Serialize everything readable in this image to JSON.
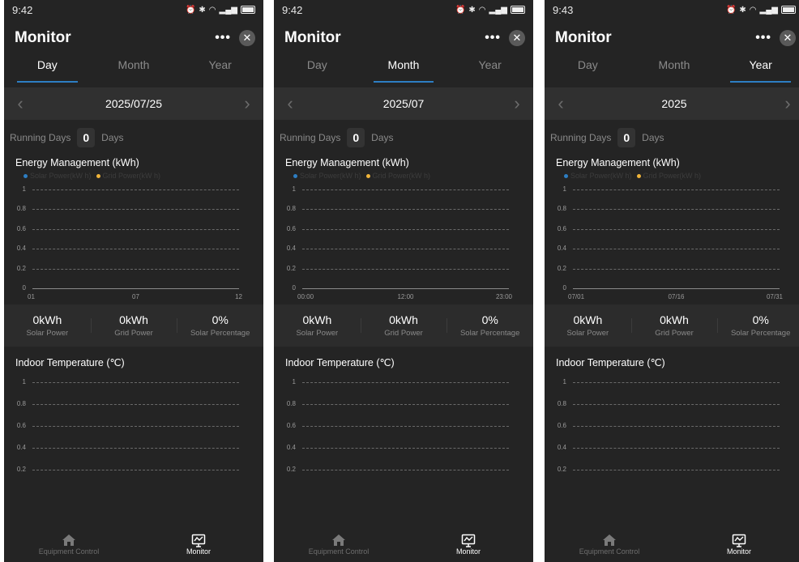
{
  "screens": [
    {
      "time": "9:42",
      "title": "Monitor",
      "tabs": [
        "Day",
        "Month",
        "Year"
      ],
      "active_tab": 0,
      "date": "2025/07/25",
      "running_days_label": "Running Days",
      "running_days_value": "0",
      "running_days_unit": "Days",
      "energy_title": "Energy Management (kWh)",
      "legend_solar": "Solar Power(kW h)",
      "legend_grid": "Grid Power(kW h)",
      "y_ticks": [
        "1",
        "0.8",
        "0.6",
        "0.4",
        "0.2",
        "0"
      ],
      "x_ticks": [
        "01",
        "07",
        "12"
      ],
      "stats": [
        {
          "value": "0kWh",
          "label": "Solar Power"
        },
        {
          "value": "0kWh",
          "label": "Grid Power"
        },
        {
          "value": "0%",
          "label": "Solar Percentage"
        }
      ],
      "temp_title": "Indoor Temperature (℃)",
      "temp_y_ticks": [
        "1",
        "0.8",
        "0.6",
        "0.4",
        "0.2"
      ],
      "nav": [
        "Equipment Control",
        "Monitor"
      ]
    },
    {
      "time": "9:42",
      "title": "Monitor",
      "tabs": [
        "Day",
        "Month",
        "Year"
      ],
      "active_tab": 1,
      "date": "2025/07",
      "running_days_label": "Running Days",
      "running_days_value": "0",
      "running_days_unit": "Days",
      "energy_title": "Energy Management (kWh)",
      "legend_solar": "Solar Power(kW h)",
      "legend_grid": "Grid Power(kW h)",
      "y_ticks": [
        "1",
        "0.8",
        "0.6",
        "0.4",
        "0.2",
        "0"
      ],
      "x_ticks": [
        "00:00",
        "12:00",
        "23:00"
      ],
      "stats": [
        {
          "value": "0kWh",
          "label": "Solar Power"
        },
        {
          "value": "0kWh",
          "label": "Grid Power"
        },
        {
          "value": "0%",
          "label": "Solar Percentage"
        }
      ],
      "temp_title": "Indoor Temperature (℃)",
      "temp_y_ticks": [
        "1",
        "0.8",
        "0.6",
        "0.4",
        "0.2"
      ],
      "nav": [
        "Equipment Control",
        "Monitor"
      ]
    },
    {
      "time": "9:43",
      "title": "Monitor",
      "tabs": [
        "Day",
        "Month",
        "Year"
      ],
      "active_tab": 2,
      "date": "2025",
      "running_days_label": "Running Days",
      "running_days_value": "0",
      "running_days_unit": "Days",
      "energy_title": "Energy Management (kWh)",
      "legend_solar": "Solar Power(kW h)",
      "legend_grid": "Grid Power(kW h)",
      "y_ticks": [
        "1",
        "0.8",
        "0.6",
        "0.4",
        "0.2",
        "0"
      ],
      "x_ticks": [
        "07/01",
        "07/16",
        "07/31"
      ],
      "stats": [
        {
          "value": "0kWh",
          "label": "Solar Power"
        },
        {
          "value": "0kWh",
          "label": "Grid Power"
        },
        {
          "value": "0%",
          "label": "Solar Percentage"
        }
      ],
      "temp_title": "Indoor Temperature (℃)",
      "temp_y_ticks": [
        "1",
        "0.8",
        "0.6",
        "0.4",
        "0.2"
      ],
      "nav": [
        "Equipment Control",
        "Monitor"
      ]
    }
  ],
  "colors": {
    "solar": "#2d7ec3",
    "grid": "#f0b43a",
    "accent": "#2d7ec3"
  },
  "icons": {
    "back": "chevron-left-icon",
    "forward": "chevron-right-icon",
    "close": "close-icon",
    "more": "more-icon",
    "home": "home-icon",
    "monitor": "monitor-icon"
  }
}
